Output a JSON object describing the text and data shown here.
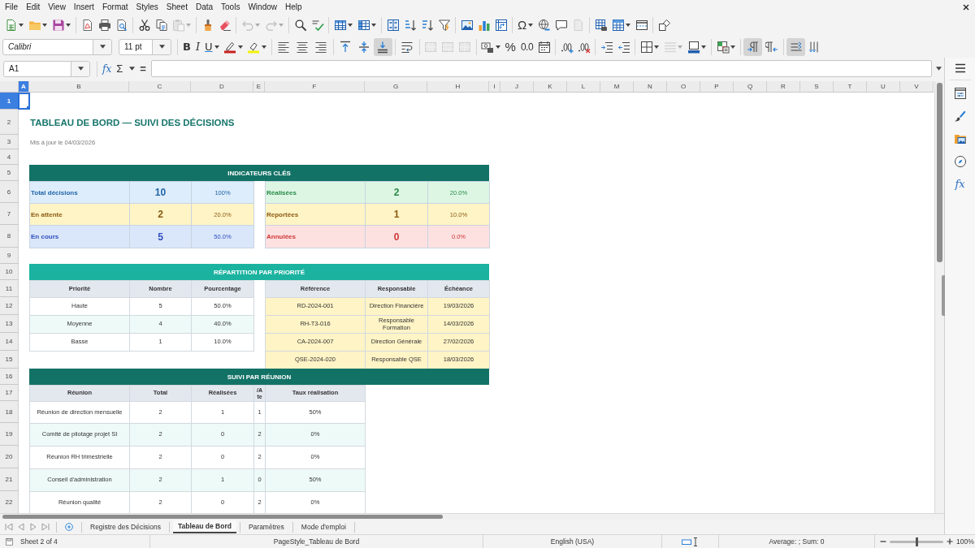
{
  "menu_bar": {
    "items": [
      "File",
      "Edit",
      "View",
      "Insert",
      "Format",
      "Styles",
      "Sheet",
      "Data",
      "Tools",
      "Window",
      "Help"
    ]
  },
  "standard_toolbar": {
    "paste": {
      "disabled": true
    },
    "undo": {
      "disabled": true
    },
    "redo": {
      "disabled": true
    },
    "special_character": {
      "label": "Ω"
    },
    "headers_footers": {
      "disabled": true
    }
  },
  "formatting_toolbar": {
    "font_name": "Calibri",
    "font_size": "11 pt",
    "bold": {
      "label": "B",
      "on": false
    },
    "italic": {
      "label": "I",
      "on": false
    },
    "underline": {
      "label": "U",
      "on": false
    },
    "align_left": {
      "on": false
    },
    "align_center": {
      "on": false
    },
    "align_right": {
      "on": false
    },
    "align_top": {
      "on": false
    },
    "align_middle": {
      "on": false
    },
    "align_bottom": {
      "on": true
    },
    "wrap_text": {
      "on": false
    },
    "merge_center": {
      "disabled": true
    },
    "merge": {
      "disabled": true
    },
    "unmerge": {
      "disabled": true
    },
    "percent": {
      "label": "%"
    },
    "number": {
      "label": "0.0"
    },
    "border_style": {
      "disabled": true
    },
    "left_to_right": {
      "on": true
    },
    "right_to_left": {
      "on": false
    },
    "text_left_to_right": {
      "on": true
    },
    "text_top_to_bottom": {
      "on": false
    }
  },
  "formula_bar": {
    "name_box": "A1",
    "function_wizard": "fx",
    "sum": "Σ",
    "equals": "="
  },
  "sheet": {
    "columns": [
      {
        "label": "A",
        "selected": true
      },
      {
        "label": "B",
        "selected": false
      },
      {
        "label": "C",
        "selected": false
      },
      {
        "label": "D",
        "selected": false
      },
      {
        "label": "E",
        "selected": false
      },
      {
        "label": "F",
        "selected": false
      },
      {
        "label": "G",
        "selected": false
      },
      {
        "label": "H",
        "selected": false
      },
      {
        "label": "I",
        "selected": false
      },
      {
        "label": "J",
        "selected": false
      },
      {
        "label": "K",
        "selected": false
      },
      {
        "label": "L",
        "selected": false
      },
      {
        "label": "M",
        "selected": false
      },
      {
        "label": "N",
        "selected": false
      },
      {
        "label": "O",
        "selected": false
      },
      {
        "label": "P",
        "selected": false
      },
      {
        "label": "Q",
        "selected": false
      },
      {
        "label": "R",
        "selected": false
      },
      {
        "label": "S",
        "selected": false
      },
      {
        "label": "T",
        "selected": false
      },
      {
        "label": "U",
        "selected": false
      },
      {
        "label": "V",
        "selected": false
      }
    ],
    "rows": [
      {
        "label": "1",
        "selected": true
      },
      {
        "label": "2",
        "selected": false
      },
      {
        "label": "3",
        "selected": false
      },
      {
        "label": "4",
        "selected": false
      },
      {
        "label": "5",
        "selected": false
      },
      {
        "label": "6",
        "selected": false
      },
      {
        "label": "7",
        "selected": false
      },
      {
        "label": "8",
        "selected": false
      },
      {
        "label": "9",
        "selected": false
      },
      {
        "label": "10",
        "selected": false
      },
      {
        "label": "11",
        "selected": false
      },
      {
        "label": "12",
        "selected": false
      },
      {
        "label": "13",
        "selected": false
      },
      {
        "label": "14",
        "selected": false
      },
      {
        "label": "15",
        "selected": false
      },
      {
        "label": "16",
        "selected": false
      },
      {
        "label": "17",
        "selected": false
      },
      {
        "label": "18",
        "selected": false
      },
      {
        "label": "19",
        "selected": false
      },
      {
        "label": "20",
        "selected": false
      },
      {
        "label": "21",
        "selected": false
      },
      {
        "label": "22",
        "selected": false
      }
    ],
    "title": "TABLEAU DE BORD — SUIVI DES DÉCISIONS",
    "updated": "Mis à jour le 04/03/2026",
    "kpi": {
      "heading": "INDICATEURS CLÉS",
      "tiles": [
        {
          "label": "Total décisions",
          "value": "10",
          "share": "100%",
          "kind": "total"
        },
        {
          "label": "Réalisées",
          "value": "2",
          "share": "20.0%",
          "kind": "done"
        },
        {
          "label": "En attente",
          "value": "2",
          "share": "20.0%",
          "kind": "pending"
        },
        {
          "label": "Reportées",
          "value": "1",
          "share": "10.0%",
          "kind": "postponed"
        },
        {
          "label": "En cours",
          "value": "5",
          "share": "50.0%",
          "kind": "progress"
        },
        {
          "label": "Annulées",
          "value": "0",
          "share": "0.0%",
          "kind": "cancelled"
        }
      ]
    },
    "distribution": {
      "heading": "RÉPARTITION PAR PRIORITÉ",
      "priority_table": {
        "columns": [
          "Priorité",
          "Nombre",
          "Pourcentage"
        ],
        "rows": [
          [
            "Haute",
            "5",
            "50.0%"
          ],
          [
            "Moyenne",
            "4",
            "40.0%"
          ],
          [
            "Basse",
            "1",
            "10.0%"
          ]
        ]
      },
      "deadline_table": {
        "columns": [
          "Référence",
          "Responsable",
          "Échéance"
        ],
        "rows": [
          [
            "RD-2024-001",
            "Direction Financière",
            "19/03/2026"
          ],
          [
            "RH-T3-016",
            "Responsable Formation",
            "14/03/2026"
          ],
          [
            "CA-2024-007",
            "Direction Générale",
            "27/02/2026"
          ],
          [
            "QSE-2024-020",
            "Responsable QSE",
            "18/03/2026"
          ]
        ]
      }
    },
    "meetings": {
      "heading": "SUIVI PAR RÉUNION",
      "columns": [
        "Réunion",
        "Total",
        "Réalisées",
        "/A te",
        "Taux réalisation"
      ],
      "rows": [
        [
          "Réunion de direction mensuelle",
          "2",
          "1",
          "1",
          "50%"
        ],
        [
          "Comité de pilotage projet SI",
          "2",
          "0",
          "2",
          "0%"
        ],
        [
          "Réunion RH trimestrielle",
          "2",
          "0",
          "2",
          "0%"
        ],
        [
          "Conseil d'administration",
          "2",
          "1",
          "0",
          "50%"
        ],
        [
          "Réunion qualité",
          "2",
          "0",
          "2",
          "0%"
        ]
      ]
    }
  },
  "sheet_tabs": [
    {
      "label": "Registre des Décisions",
      "selected": false
    },
    {
      "label": "Tableau de Bord",
      "selected": true
    },
    {
      "label": "Paramètres",
      "selected": false
    },
    {
      "label": "Mode d'emploi",
      "selected": false
    }
  ],
  "sidebar": {
    "functions": "fx"
  },
  "status_bar": {
    "sheet_position": "Sheet 2 of 4",
    "page_style": "PageStyle_Tableau de Bord",
    "language": "English (USA)",
    "summary": "Average: ; Sum: 0",
    "zoom": {
      "level": 0.5,
      "percent": "100%"
    }
  }
}
